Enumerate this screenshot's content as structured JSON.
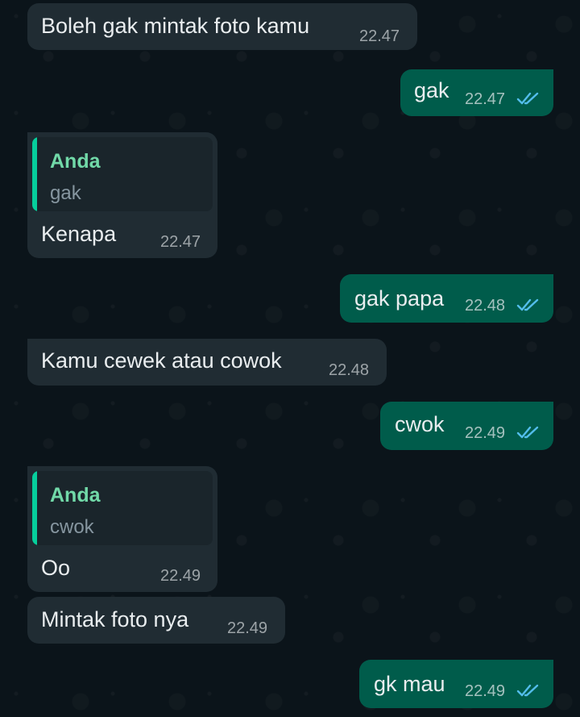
{
  "messages": [
    {
      "direction": "in",
      "text": "Boleh gak mintak foto kamu",
      "time": "22.47"
    },
    {
      "direction": "out",
      "text": "gak",
      "time": "22.47",
      "status": "read"
    },
    {
      "direction": "in",
      "quote": {
        "author": "Anda",
        "text": "gak"
      },
      "text": "Kenapa",
      "time": "22.47"
    },
    {
      "direction": "out",
      "text": "gak papa",
      "time": "22.48",
      "status": "read"
    },
    {
      "direction": "in",
      "text": "Kamu cewek atau cowok",
      "time": "22.48"
    },
    {
      "direction": "out",
      "text": "cwok",
      "time": "22.49",
      "status": "read"
    },
    {
      "direction": "in",
      "quote": {
        "author": "Anda",
        "text": "cwok"
      },
      "text": "Oo",
      "time": "22.49"
    },
    {
      "direction": "in",
      "text": "Mintak foto nya",
      "time": "22.49"
    },
    {
      "direction": "out",
      "text": "gk mau",
      "time": "22.49",
      "status": "read"
    }
  ],
  "colors": {
    "background": "#0b141a",
    "incoming_bubble": "#202c33",
    "outgoing_bubble": "#005c4b",
    "read_ticks": "#53bdeb",
    "quote_author": "#71d9a8"
  }
}
